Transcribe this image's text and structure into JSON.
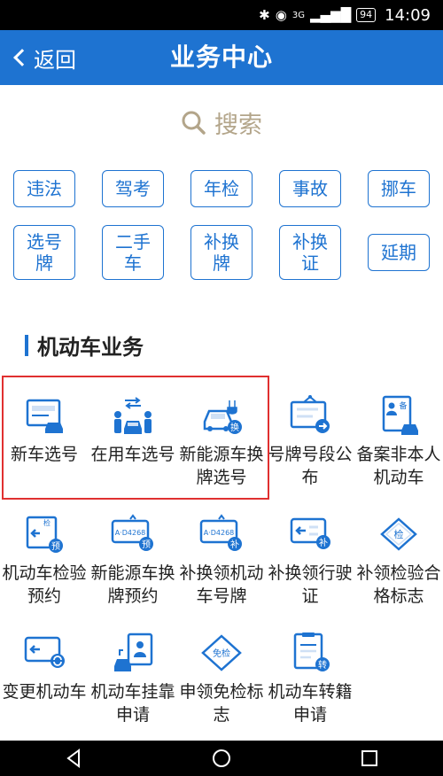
{
  "status_bar": {
    "icons": [
      "bluetooth-icon",
      "eye-icon",
      "signal-icon"
    ],
    "network": "3G",
    "battery": "94",
    "time": "14:09"
  },
  "header": {
    "back_label": "返回",
    "title": "业务中心"
  },
  "search": {
    "label": "搜索",
    "icon": "search-icon"
  },
  "quick_tags": [
    {
      "label": "违法"
    },
    {
      "label": "驾考"
    },
    {
      "label": "年检"
    },
    {
      "label": "事故"
    },
    {
      "label": "挪车"
    },
    {
      "label": "选号牌"
    },
    {
      "label": "二手车"
    },
    {
      "label": "补换牌"
    },
    {
      "label": "补换证"
    },
    {
      "label": "延期"
    }
  ],
  "section": {
    "title": "机动车业务"
  },
  "services": [
    {
      "label": "新车选号",
      "icon": "new-car-plate-icon"
    },
    {
      "label": "在用车选号",
      "icon": "used-car-select-icon"
    },
    {
      "label": "新能源车换牌选号",
      "icon": "ev-plate-icon",
      "badge": "换"
    },
    {
      "label": "号牌号段公布",
      "icon": "plate-notice-icon"
    },
    {
      "label": "备案非本人机动车",
      "icon": "record-car-icon",
      "badge": "备"
    },
    {
      "label": "机动车检验预约",
      "icon": "inspection-booking-icon",
      "badge": "预",
      "tag": "检"
    },
    {
      "label": "新能源车换牌预约",
      "icon": "ev-plate-booking-icon",
      "badge": "预",
      "plate": "A·D4268"
    },
    {
      "label": "补换领机动车号牌",
      "icon": "replace-plate-icon",
      "badge": "补",
      "plate": "A·D4268"
    },
    {
      "label": "补换领行驶证",
      "icon": "replace-license-icon",
      "badge": "补"
    },
    {
      "label": "补领检验合格标志",
      "icon": "inspection-mark-icon",
      "tag": "检"
    },
    {
      "label": "变更机动车",
      "icon": "change-car-icon"
    },
    {
      "label": "机动车挂靠申请",
      "icon": "affiliation-icon"
    },
    {
      "label": "申领免检标志",
      "icon": "exempt-mark-icon",
      "tag": "免检"
    },
    {
      "label": "机动车转籍申请",
      "icon": "transfer-icon",
      "badge": "转"
    }
  ],
  "colors": {
    "primary": "#1e73d1",
    "search_text": "#b3a58a",
    "highlight": "#e03030",
    "badge": "#1e73d1"
  }
}
